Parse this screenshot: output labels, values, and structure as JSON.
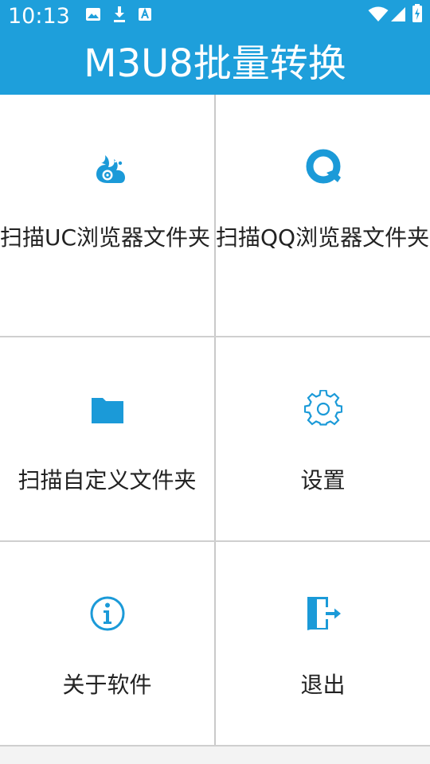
{
  "status_bar": {
    "time": "10:13",
    "icons": [
      "image-icon",
      "download-icon",
      "font-icon",
      "wifi-icon",
      "signal-icon",
      "battery-icon"
    ]
  },
  "app_bar": {
    "title": "M3U8批量转换"
  },
  "colors": {
    "accent": "#1e9fdb",
    "icon": "#1b9ad8",
    "divider": "#c9c9c9",
    "text": "#222222"
  },
  "menu": {
    "scan_uc": {
      "label": "扫描UC浏览器文件夹",
      "icon": "uc-browser-icon"
    },
    "scan_qq": {
      "label": "扫描QQ浏览器文件夹",
      "icon": "qq-browser-icon"
    },
    "scan_custom": {
      "label": "扫描自定义文件夹",
      "icon": "folder-icon"
    },
    "settings": {
      "label": "设置",
      "icon": "gear-icon"
    },
    "about": {
      "label": "关于软件",
      "icon": "info-icon"
    },
    "exit": {
      "label": "退出",
      "icon": "exit-icon"
    }
  }
}
